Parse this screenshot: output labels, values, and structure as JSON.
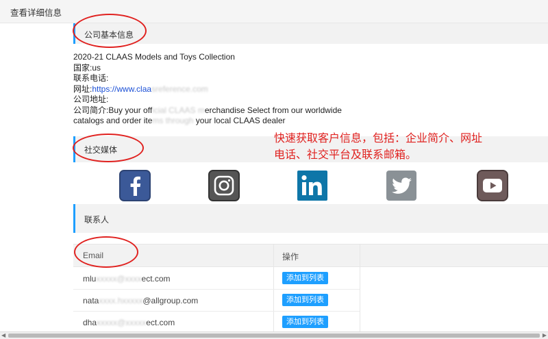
{
  "header": {
    "title": "查看详细信息"
  },
  "sections": {
    "company": "公司基本信息",
    "social": "社交媒体",
    "contacts": "联系人"
  },
  "company_info": {
    "name": "2020-21 CLAAS Models and Toys Collection",
    "country": "国家:us",
    "phone_label": "联系电话:",
    "website_label": "网址:",
    "website_visible": "https://www.claa",
    "website_blurred": "sreference.com",
    "address_label": "公司地址:",
    "intro_prefix": "公司简介:Buy your off",
    "intro_blur1": "icial CLAAS m",
    "intro_mid": "erchandise Select from our worldwide",
    "intro_line2_a": "catalogs and order ite",
    "intro_blur2": "ms through",
    "intro_line2_b": " your local CLAAS dealer"
  },
  "annotation": {
    "line1": "快速获取客户信息，包括：企业简介、网址",
    "line2": "电话、社交平台及联系邮箱。"
  },
  "social_icons": [
    "facebook-icon",
    "instagram-icon",
    "linkedin-icon",
    "twitter-icon",
    "youtube-icon"
  ],
  "colors": {
    "accent": "#1e9fff",
    "annotation_red": "#e0211f",
    "facebook": "#3b5998",
    "instagram": "#555555",
    "linkedin": "#0e76a8",
    "twitter": "#8a9196",
    "youtube": "#6e5a5a"
  },
  "table": {
    "headers": [
      "Email",
      "操作"
    ],
    "rows": [
      {
        "email_a": "mlu",
        "email_blur": "xxxxx@xxxx",
        "email_b": "ect.com",
        "action": "添加到列表"
      },
      {
        "email_a": "nata",
        "email_blur": "xxxx.hxxxxx",
        "email_b": "@allgroup.com",
        "action": "添加到列表"
      },
      {
        "email_a": "dha",
        "email_blur": "xxxxx@xxxxx",
        "email_b": "ect.com",
        "action": "添加到列表"
      }
    ]
  }
}
